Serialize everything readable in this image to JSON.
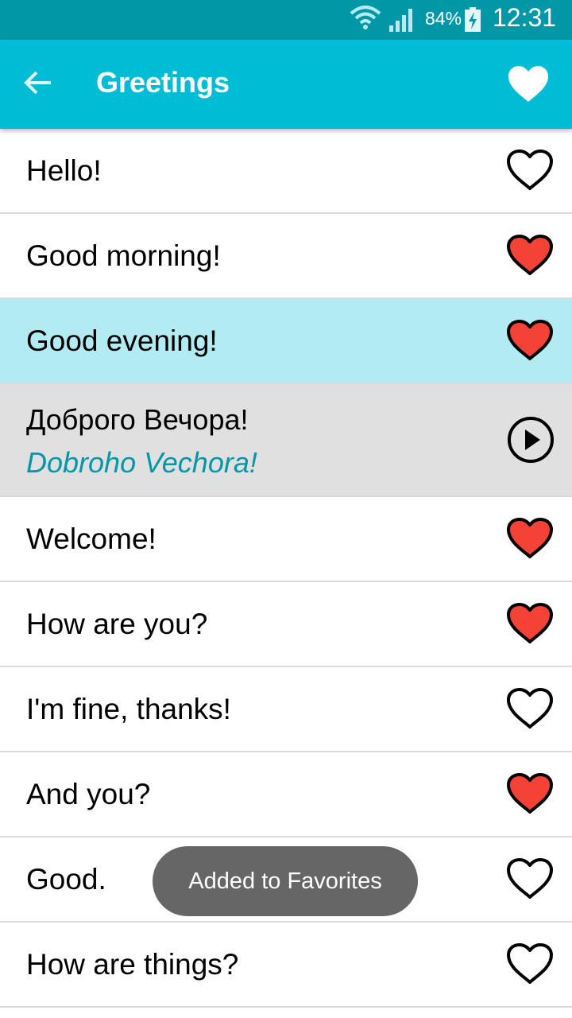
{
  "status_bar": {
    "battery_percent": "84%",
    "time": "12:31",
    "icons": [
      "wifi-icon",
      "signal-icon",
      "battery-charging-icon"
    ]
  },
  "app_bar": {
    "title": "Greetings",
    "back_icon": "arrow-left-icon",
    "favorite_icon": "heart-filled-icon"
  },
  "colors": {
    "status_bar": "#0097a7",
    "app_bar": "#00bcd4",
    "selected_row": "#b2ebf2",
    "expanded_row": "#e0e0e0",
    "transliteration": "#0097a7",
    "favorite_heart": "#f44336",
    "toast": "#666666"
  },
  "phrases": [
    {
      "text": "Hello!",
      "favorite": false
    },
    {
      "text": "Good morning!",
      "favorite": true
    },
    {
      "text": "Good evening!",
      "favorite": true,
      "selected": true
    },
    {
      "text": "Welcome!",
      "favorite": true
    },
    {
      "text": "How are you?",
      "favorite": true
    },
    {
      "text": "I'm fine, thanks!",
      "favorite": false
    },
    {
      "text": "And you?",
      "favorite": true
    },
    {
      "text": "Good.",
      "favorite": false
    },
    {
      "text": "How are things?",
      "favorite": false
    }
  ],
  "expanded": {
    "native": "Доброго Вечора!",
    "transliteration": "Dobroho Vechora!",
    "play_icon": "play-circle-icon"
  },
  "toast": {
    "text": "Added to Favorites"
  }
}
